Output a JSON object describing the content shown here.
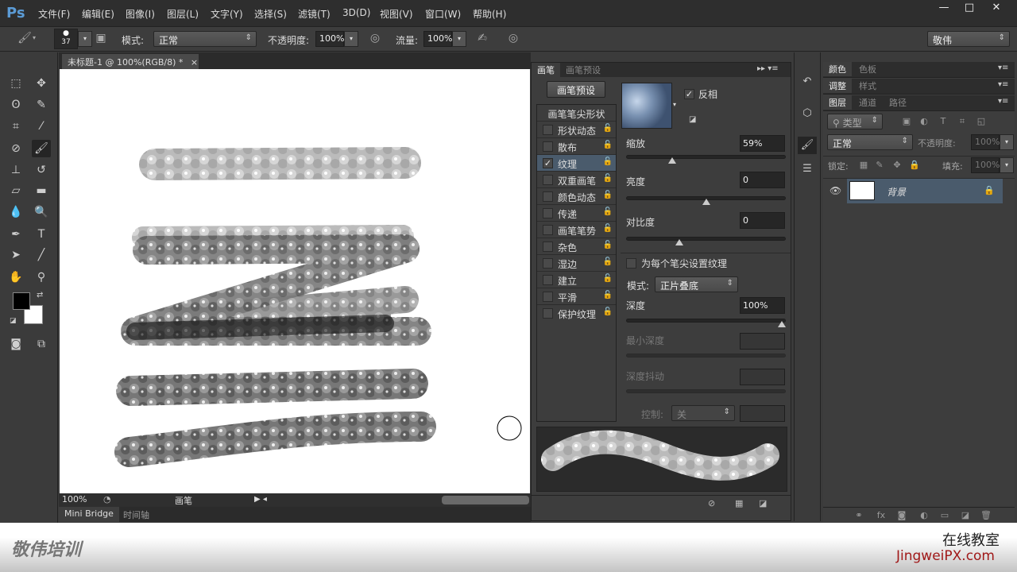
{
  "app": {
    "logo": "Ps",
    "menus": [
      "文件(F)",
      "编辑(E)",
      "图像(I)",
      "图层(L)",
      "文字(Y)",
      "选择(S)",
      "滤镜(T)",
      "3D(D)",
      "视图(V)",
      "窗口(W)",
      "帮助(H)"
    ],
    "window_controls": [
      "minimize",
      "maximize",
      "close"
    ]
  },
  "options": {
    "brush_size": "37",
    "mode_label": "模式:",
    "mode_value": "正常",
    "opacity_label": "不透明度:",
    "opacity_value": "100%",
    "flow_label": "流量:",
    "flow_value": "100%",
    "workspace": "敬伟"
  },
  "document": {
    "tab_title": "未标题-1 @ 100%(RGB/8) *",
    "close": "×",
    "zoom": "100%",
    "status_info": "画笔"
  },
  "bottom_tabs": [
    "Mini Bridge",
    "时间轴"
  ],
  "tools": [
    "marquee-icon",
    "move-icon",
    "lasso-icon",
    "quick-select-icon",
    "crop-icon",
    "eyedropper-icon",
    "healing-icon",
    "brush-icon",
    "stamp-icon",
    "history-brush-icon",
    "eraser-icon",
    "gradient-icon",
    "blur-icon",
    "dodge-icon",
    "pen-icon",
    "type-icon",
    "path-select-icon",
    "line-icon",
    "hand-icon",
    "zoom-icon"
  ],
  "colors": {
    "foreground": "#000000",
    "background": "#ffffff",
    "accent_selected": "#4a5b6c"
  },
  "brush_panel": {
    "tabs": [
      "画笔",
      "画笔预设"
    ],
    "preset_button": "画笔预设",
    "tip_shape": "画笔笔尖形状",
    "items": [
      {
        "label": "形状动态",
        "checked": false
      },
      {
        "label": "散布",
        "checked": false
      },
      {
        "label": "纹理",
        "checked": true,
        "selected": true
      },
      {
        "label": "双重画笔",
        "checked": false
      },
      {
        "label": "颜色动态",
        "checked": false
      },
      {
        "label": "传递",
        "checked": false
      },
      {
        "label": "画笔笔势",
        "checked": false
      },
      {
        "label": "杂色",
        "checked": false
      },
      {
        "label": "湿边",
        "checked": false
      },
      {
        "label": "建立",
        "checked": false
      },
      {
        "label": "平滑",
        "checked": false
      },
      {
        "label": "保护纹理",
        "checked": false
      }
    ],
    "invert_label": "反相",
    "invert_checked": true,
    "scale_label": "缩放",
    "scale_value": "59%",
    "scale_pct": 59,
    "brightness_label": "亮度",
    "brightness_value": "0",
    "contrast_label": "对比度",
    "contrast_value": "0",
    "per_tip_label": "为每个笔尖设置纹理",
    "per_tip_checked": false,
    "mode_label": "模式:",
    "mode_value": "正片叠底",
    "depth_label": "深度",
    "depth_value": "100%",
    "depth_pct": 100,
    "min_depth_label": "最小深度",
    "depth_jitter_label": "深度抖动",
    "control_label": "控制:",
    "control_value": "关"
  },
  "right_panels": {
    "color_tabs": [
      "颜色",
      "色板"
    ],
    "adjust_tabs": [
      "调整",
      "样式"
    ],
    "layer_tabs": [
      "图层",
      "通道",
      "路径"
    ],
    "filter_kind": "类型",
    "blend_mode": "正常",
    "opacity_label": "不透明度:",
    "opacity_value": "100%",
    "lock_label": "锁定:",
    "fill_label": "填充:",
    "fill_value": "100%",
    "layers": [
      {
        "name": "背景",
        "visible": true,
        "locked": true
      }
    ]
  },
  "watermark": {
    "left": "敬伟培训",
    "right_top": "在线教室",
    "right_bottom": "JingweiPX.com"
  }
}
